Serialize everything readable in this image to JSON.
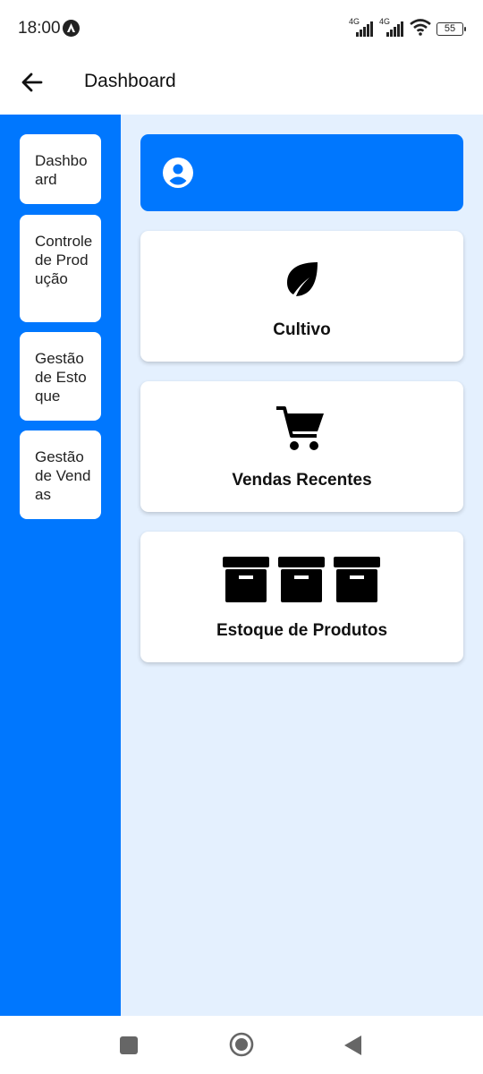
{
  "status_bar": {
    "time": "18:00",
    "network_1": "4G",
    "network_2": "4G",
    "battery": "55",
    "icons": [
      "notification-icon",
      "signal-icon",
      "signal-icon",
      "wifi-icon",
      "battery-icon"
    ]
  },
  "app_bar": {
    "title": "Dashboard",
    "back_icon": "arrow-left-icon"
  },
  "sidebar": {
    "items": [
      {
        "label": "Dashboard"
      },
      {
        "label": "Controle de Produção"
      },
      {
        "label": "Gestão de Estoque"
      },
      {
        "label": "Gestão de Vendas"
      }
    ]
  },
  "main": {
    "profile_icon": "account-circle-icon",
    "cards": [
      {
        "label": "Cultivo",
        "icon": "leaf-icon"
      },
      {
        "label": "Vendas Recentes",
        "icon": "shopping-cart-icon"
      },
      {
        "label": "Estoque de Produtos",
        "icon": "archive-box-icon"
      }
    ]
  },
  "nav_bar": {
    "icons": [
      "recent-apps-icon",
      "home-icon",
      "back-triangle-icon"
    ]
  },
  "colors": {
    "primary": "#0077fe",
    "main_background": "#e4f0fe",
    "card_background": "#ffffff"
  }
}
